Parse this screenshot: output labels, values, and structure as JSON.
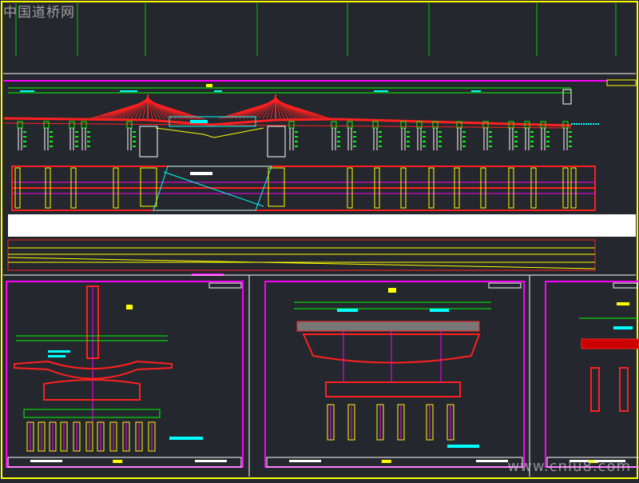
{
  "watermark": {
    "top_left": "中国道桥网",
    "bottom_right": "www.cnlu8.com"
  },
  "colors": {
    "background": "#24272d",
    "border": "#ffff00",
    "deck": "#ff0000",
    "cable": "#ff2020",
    "column": "#ff0000",
    "dimension": "#00ff00",
    "annotation": "#00ffff",
    "frame": "#ff00ff",
    "label": "#ffff00",
    "white": "#ffffff"
  },
  "sheets": [
    {
      "name": "section-sheet-1",
      "title_block": true
    },
    {
      "name": "section-sheet-2",
      "title_block": true
    },
    {
      "name": "section-sheet-3",
      "title_block": true
    }
  ]
}
